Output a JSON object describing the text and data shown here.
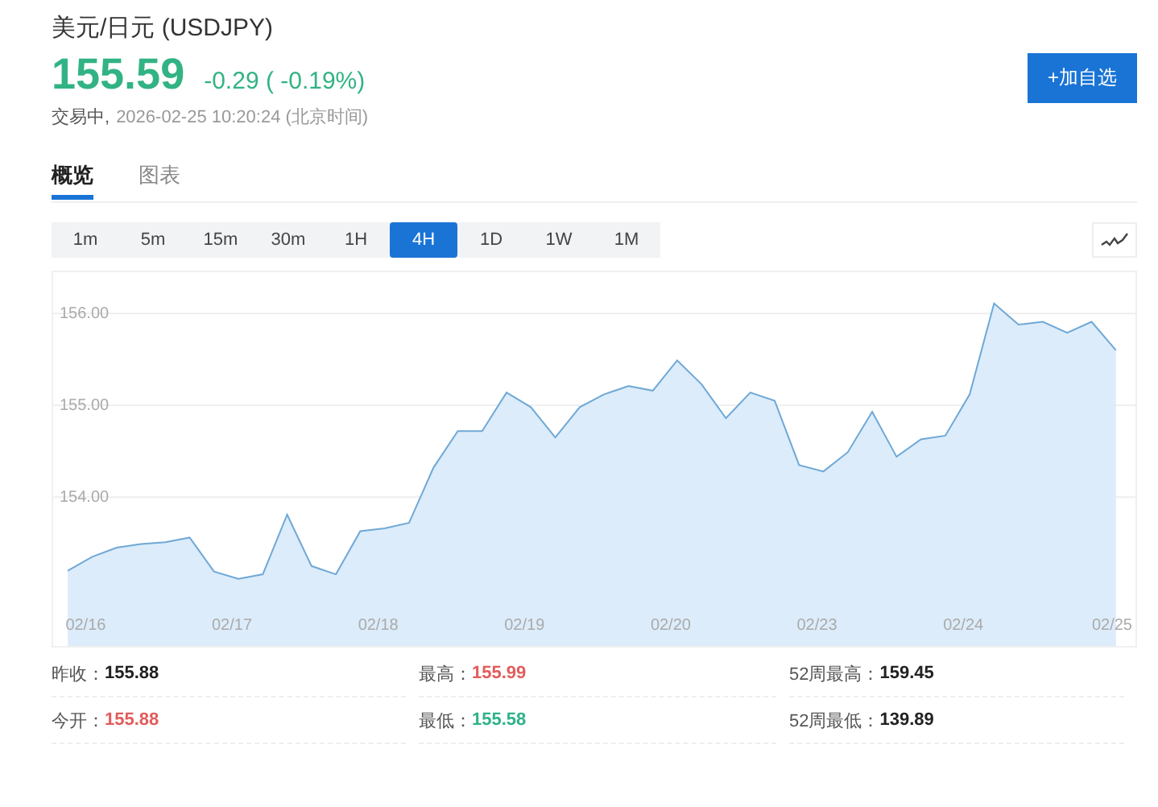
{
  "header": {
    "title": "美元/日元 (USDJPY)",
    "price": "155.59",
    "change": "-0.29",
    "change_pct": "( -0.19%)",
    "status": "交易中,",
    "time": "2026-02-25 10:20:24",
    "timezone": "(北京时间)",
    "watch_button": "+加自选"
  },
  "tabs": [
    {
      "label": "概览",
      "selected": true
    },
    {
      "label": "图表",
      "selected": false
    }
  ],
  "periods": [
    {
      "label": "1m",
      "selected": false
    },
    {
      "label": "5m",
      "selected": false
    },
    {
      "label": "15m",
      "selected": false
    },
    {
      "label": "30m",
      "selected": false
    },
    {
      "label": "1H",
      "selected": false
    },
    {
      "label": "4H",
      "selected": true
    },
    {
      "label": "1D",
      "selected": false
    },
    {
      "label": "1W",
      "selected": false
    },
    {
      "label": "1M",
      "selected": false
    }
  ],
  "chart": {
    "chart_data": {
      "type": "area",
      "categories": [
        null,
        "02/16",
        null,
        null,
        null,
        null,
        null,
        "02/17",
        null,
        null,
        null,
        null,
        null,
        "02/18",
        null,
        null,
        null,
        null,
        null,
        "02/19",
        null,
        null,
        null,
        null,
        null,
        "02/20",
        null,
        null,
        null,
        null,
        null,
        "02/23",
        null,
        null,
        null,
        null,
        null,
        "02/24",
        null,
        null,
        null,
        null,
        null,
        "02/25"
      ],
      "series": [
        {
          "color": "#6fa8d6",
          "values": [
            153.2,
            153.35,
            153.45,
            153.49,
            153.51,
            153.56,
            153.19,
            153.11,
            153.16,
            153.81,
            153.25,
            153.16,
            153.63,
            153.66,
            153.72,
            154.32,
            154.72,
            154.72,
            155.14,
            154.98,
            154.65,
            154.98,
            155.12,
            155.21,
            155.16,
            155.49,
            155.23,
            154.86,
            155.14,
            155.05,
            154.35,
            154.28,
            154.49,
            154.93,
            154.44,
            154.63,
            154.67,
            155.12,
            156.11,
            155.88,
            155.91,
            155.79,
            155.91,
            155.6
          ]
        }
      ],
      "ylim": [
        152.38,
        156.45
      ],
      "grid": true,
      "yticks": [
        {
          "value": 154,
          "label": "154.00"
        },
        {
          "value": 155,
          "label": "155.00"
        },
        {
          "value": 156,
          "label": "156.00"
        }
      ]
    }
  },
  "stats": [
    {
      "label": "昨收：",
      "value": "155.88",
      "color": "#222222"
    },
    {
      "label": "最高：",
      "value": "155.99",
      "color": "#e25c5c"
    },
    {
      "label": "52周最高：",
      "value": "159.45",
      "color": "#222222"
    },
    {
      "label": "今开：",
      "value": "155.88",
      "color": "#e25c5c"
    },
    {
      "label": "最低：",
      "value": "155.58",
      "color": "#2fb28a"
    },
    {
      "label": "52周最低：",
      "value": "139.89",
      "color": "#222222"
    }
  ]
}
